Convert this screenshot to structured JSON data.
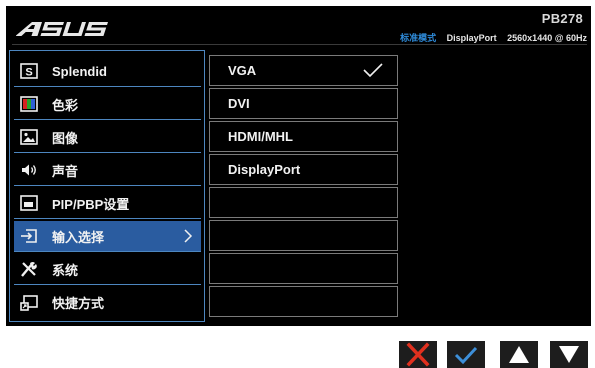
{
  "logo": {
    "text": "ASUS"
  },
  "header": {
    "model": "PB278",
    "mode": "标准模式",
    "input": "DisplayPort",
    "resolution": "2560x1440 @ 60Hz"
  },
  "menu": {
    "items": [
      {
        "label": "Splendid",
        "icon": "splendid-icon"
      },
      {
        "label": "色彩",
        "icon": "color-icon"
      },
      {
        "label": "图像",
        "icon": "image-icon"
      },
      {
        "label": "声音",
        "icon": "speaker-icon"
      },
      {
        "label": "PIP/PBP设置",
        "icon": "pip-icon"
      },
      {
        "label": "输入选择",
        "icon": "input-select-icon",
        "selected": true
      },
      {
        "label": "系统",
        "icon": "system-tools-icon"
      },
      {
        "label": "快捷方式",
        "icon": "shortcut-icon"
      }
    ]
  },
  "options": {
    "items": [
      {
        "label": "VGA",
        "checked": true
      },
      {
        "label": "DVI"
      },
      {
        "label": "HDMI/MHL"
      },
      {
        "label": "DisplayPort"
      },
      {
        "label": ""
      },
      {
        "label": ""
      },
      {
        "label": ""
      },
      {
        "label": ""
      }
    ]
  },
  "buttons": [
    {
      "icon": "close-icon",
      "color": "#e0301e"
    },
    {
      "icon": "check-icon",
      "color": "#3d8fd9"
    },
    {
      "icon": "up-arrow-icon",
      "color": "#ffffff"
    },
    {
      "icon": "down-arrow-icon",
      "color": "#ffffff"
    }
  ],
  "colors": {
    "accent": "#2a5ca0",
    "border": "#4d86bf",
    "background": "#000000"
  }
}
